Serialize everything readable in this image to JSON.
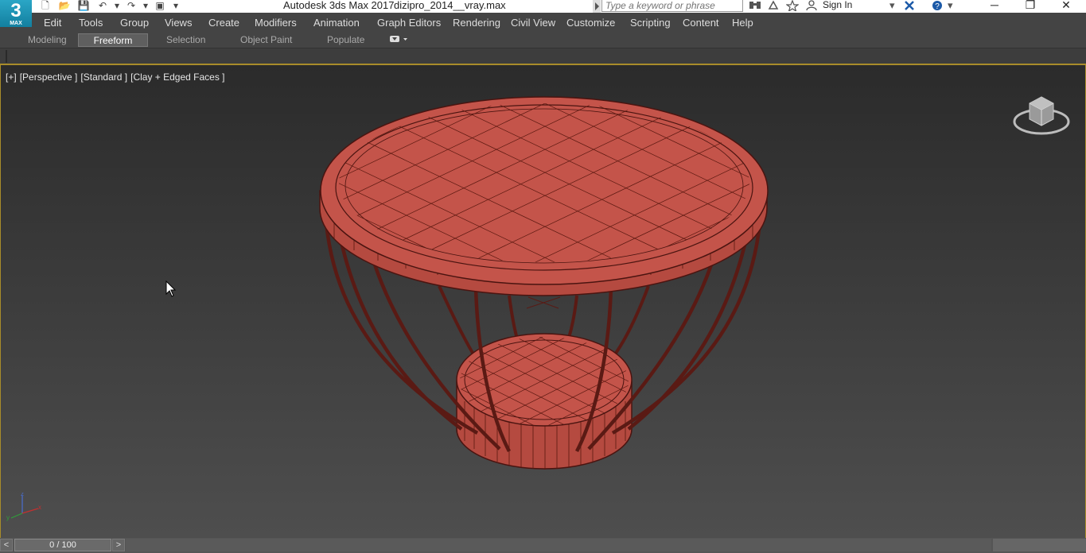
{
  "window": {
    "app_title": "Autodesk 3ds Max 2017",
    "file_name": "dizipro_2014__vray.max",
    "logo_text": "3",
    "logo_sub": "MAX",
    "search_placeholder": "Type a keyword or phrase",
    "sign_in_label": "Sign In",
    "minimize_glyph": "─",
    "restore_glyph": "❐",
    "close_glyph": "✕"
  },
  "quick_access": {
    "new_glyph": "🗋",
    "open_glyph": "📂",
    "save_glyph": "💾",
    "undo_glyph": "↶",
    "redo_glyph": "↷",
    "project_glyph": "▣",
    "dropdown_glyph": "▾"
  },
  "menu": {
    "items": [
      "Edit",
      "Tools",
      "Group",
      "Views",
      "Create",
      "Modifiers",
      "Animation",
      "Graph Editors",
      "Rendering",
      "Civil View",
      "Customize",
      "Scripting",
      "Content",
      "Help"
    ]
  },
  "ribbon": {
    "tabs": [
      "Modeling",
      "Freeform",
      "Selection",
      "Object Paint",
      "Populate"
    ],
    "active_tab": "Freeform"
  },
  "viewport": {
    "labels": [
      "[+]",
      "[Perspective ]",
      "[Standard ]",
      "[Clay + Edged Faces ]"
    ],
    "axis_x": "x",
    "axis_y": "y",
    "axis_z": "z"
  },
  "timeline": {
    "frame_readout": "0 / 100",
    "prev_label": "<",
    "next_label": ">"
  },
  "colors": {
    "accent_border": "#a88c2a",
    "model_fill": "#c4544a",
    "model_edge": "#4a1410"
  }
}
